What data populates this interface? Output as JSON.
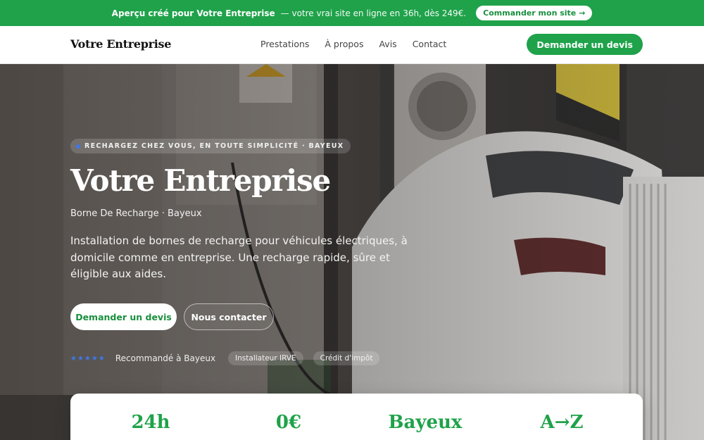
{
  "promo": {
    "lead": "Aperçu créé pour Votre Entreprise",
    "rest": "— votre vrai site en ligne en 36h, dès 249€.",
    "button": "Commander mon site →"
  },
  "header": {
    "brand": "Votre Entreprise",
    "nav": [
      "Prestations",
      "À propos",
      "Avis",
      "Contact"
    ],
    "cta": "Demander un devis"
  },
  "hero": {
    "chip": "RECHARGEZ CHEZ VOUS, EN TOUTE SIMPLICITÉ · BAYEUX",
    "title": "Votre Entreprise",
    "subtitle": "Borne De Recharge · Bayeux",
    "description": "Installation de bornes de recharge pour véhicules électriques, à domicile comme en entreprise. Une recharge rapide, sûre et éligible aux aides.",
    "primary_button": "Demander un devis",
    "secondary_button": "Nous contacter",
    "stars": "★★★★★",
    "rating_count": 5,
    "trust_text": "Recommandé à Bayeux",
    "badges": [
      "Installateur IRVE",
      "Crédit d'impôt"
    ]
  },
  "stats": [
    "24h",
    "0€",
    "Bayeux",
    "A→Z"
  ],
  "colors": {
    "brand_green": "#1fa24a",
    "star_blue": "#3e78e8",
    "white": "#ffffff"
  }
}
